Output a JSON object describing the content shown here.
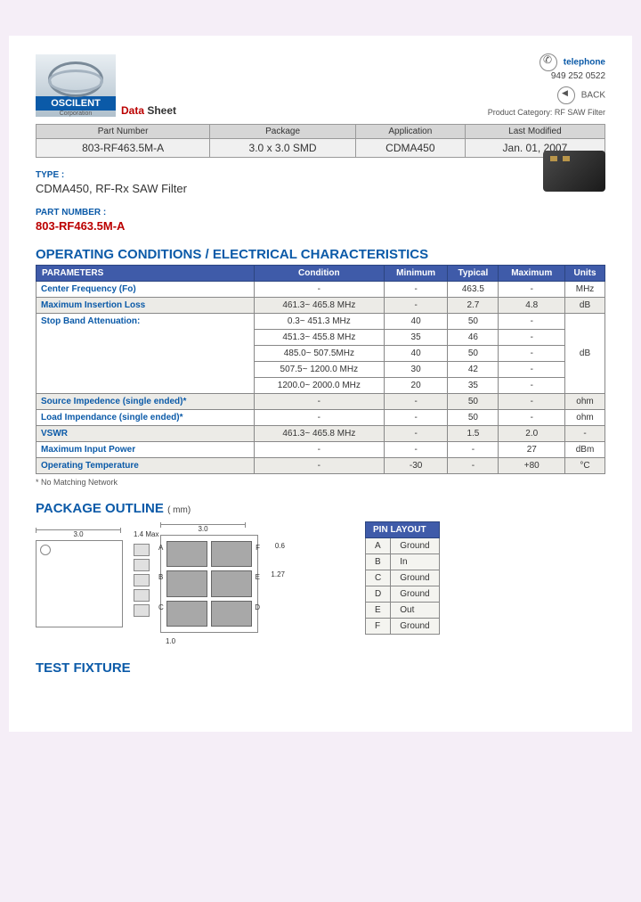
{
  "logo": {
    "name": "OSCILENT",
    "sub": "Corporation"
  },
  "datasheet": {
    "data": "Data",
    "sheet": " Sheet"
  },
  "contact": {
    "tel_label": "telephone",
    "tel_num": "949 252 0522",
    "back": "BACK",
    "category_label": "Product Category: ",
    "category": "RF SAW Filter"
  },
  "info": {
    "headers": [
      "Part Number",
      "Package",
      "Application",
      "Last Modified"
    ],
    "values": [
      "803-RF463.5M-A",
      "3.0 x 3.0 SMD",
      "CDMA450",
      "Jan. 01, 2007"
    ]
  },
  "type": {
    "label": "TYPE :",
    "value": "CDMA450, RF-Rx SAW Filter"
  },
  "partnum": {
    "label": "PART NUMBER :",
    "value": "803-RF463.5M-A"
  },
  "spec": {
    "title": "OPERATING CONDITIONS / ELECTRICAL CHARACTERISTICS",
    "headers": [
      "PARAMETERS",
      "Condition",
      "Minimum",
      "Typical",
      "Maximum",
      "Units"
    ],
    "rows": [
      {
        "param": "Center Frequency (Fo)",
        "cond": "-",
        "min": "-",
        "typ": "463.5",
        "max": "-",
        "unit": "MHz",
        "alt": false
      },
      {
        "param": "Maximum Insertion Loss",
        "cond": "461.3~ 465.8 MHz",
        "min": "-",
        "typ": "2.7",
        "max": "4.8",
        "unit": "dB",
        "alt": true
      },
      {
        "param": "Stop Band Attenuation:",
        "cond": "0.3~ 451.3 MHz",
        "min": "40",
        "typ": "50",
        "max": "-",
        "unit": "",
        "alt": false,
        "rowspan": 5,
        "unit_rowspan": "dB"
      },
      {
        "param": "",
        "cond": "451.3~ 455.8 MHz",
        "min": "35",
        "typ": "46",
        "max": "-",
        "unit": "",
        "alt": false
      },
      {
        "param": "",
        "cond": "485.0~ 507.5MHz",
        "min": "40",
        "typ": "50",
        "max": "-",
        "unit": "",
        "alt": false
      },
      {
        "param": "",
        "cond": "507.5~ 1200.0 MHz",
        "min": "30",
        "typ": "42",
        "max": "-",
        "unit": "",
        "alt": false
      },
      {
        "param": "",
        "cond": "1200.0~ 2000.0 MHz",
        "min": "20",
        "typ": "35",
        "max": "-",
        "unit": "",
        "alt": false
      },
      {
        "param": "Source Impedence (single ended)*",
        "cond": "-",
        "min": "-",
        "typ": "50",
        "max": "-",
        "unit": "ohm",
        "alt": true
      },
      {
        "param": "Load Impendance (single ended)*",
        "cond": "-",
        "min": "-",
        "typ": "50",
        "max": "-",
        "unit": "ohm",
        "alt": false
      },
      {
        "param": "VSWR",
        "cond": "461.3~ 465.8 MHz",
        "min": "-",
        "typ": "1.5",
        "max": "2.0",
        "unit": "-",
        "alt": true
      },
      {
        "param": "Maximum Input Power",
        "cond": "-",
        "min": "-",
        "typ": "-",
        "max": "27",
        "unit": "dBm",
        "alt": false
      },
      {
        "param": "Operating Temperature",
        "cond": "-",
        "min": "-30",
        "typ": "-",
        "max": "+80",
        "unit": "°C",
        "alt": true
      }
    ],
    "footnote": "* No Matching Network"
  },
  "pkg": {
    "title": "PACKAGE OUTLINE",
    "unit": "( mm)",
    "dims": {
      "w": "3.0",
      "h": "1.4 Max",
      "pad_w": "3.0",
      "pad_h": "0.6",
      "pitch": "1.27",
      "edge": "1.0"
    },
    "pin_title": "PIN LAYOUT",
    "pins": [
      {
        "pin": "A",
        "fn": "Ground"
      },
      {
        "pin": "B",
        "fn": "In"
      },
      {
        "pin": "C",
        "fn": "Ground"
      },
      {
        "pin": "D",
        "fn": "Ground"
      },
      {
        "pin": "E",
        "fn": "Out"
      },
      {
        "pin": "F",
        "fn": "Ground"
      }
    ]
  },
  "test_fixture": "TEST FIXTURE"
}
